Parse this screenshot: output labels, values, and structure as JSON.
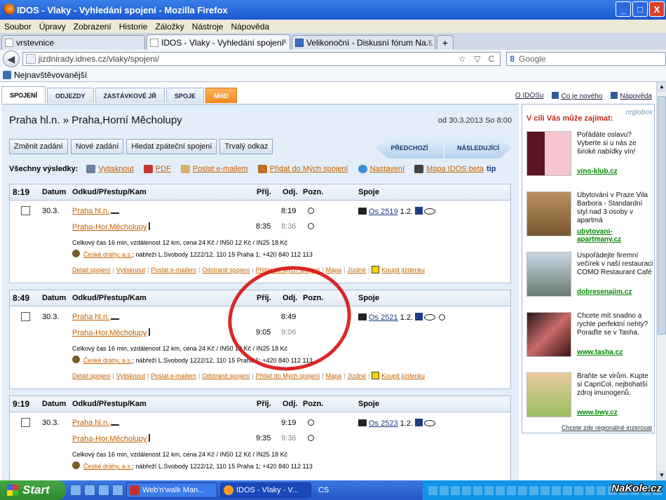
{
  "window": {
    "title": "IDOS - Vlaky - Vyhledání spojení - Mozilla Firefox",
    "min": "_",
    "max": "□",
    "close": "X"
  },
  "menu": [
    "Soubor",
    "Úpravy",
    "Zobrazení",
    "Historie",
    "Záložky",
    "Nástroje",
    "Nápověda"
  ],
  "tabs": [
    {
      "label": "vrstevnice"
    },
    {
      "label": "IDOS - Vlaky - Vyhledání spojení",
      "close": "x"
    },
    {
      "label": "Velikonoční - Diskusní fórum Na...",
      "close": "x"
    }
  ],
  "newtab": "+",
  "url": "jizdnirady.idnes.cz/vlaky/spojeni/",
  "url_icons": "☆ ▽ C",
  "search": {
    "engine": "8",
    "placeholder": "Google"
  },
  "bookmark": "Nejnavštěvovanější",
  "site": {
    "tabs": [
      "SPOJENÍ",
      "ODJEZDY",
      "ZASTÁVKOVÉ JŘ",
      "SPOJE",
      "MHD"
    ],
    "toplinks": [
      "O IDOSu",
      "Co je nového",
      "Nápověda"
    ],
    "route": "Praha hl.n. » Praha,Horní Měcholupy",
    "date": "od 30.3.2013 So 8:00",
    "buttons": [
      "Změnit zadání",
      "Nové zadání",
      "Hledat zpáteční spojení",
      "Trvalý odkaz"
    ],
    "prev": "PŘEDCHOZÍ",
    "next": "NÁSLEDUJÍCÍ",
    "all_results": "Všechny výsledky:",
    "actions": [
      "Vytisknout",
      "PDF",
      "Poslat e-mailem",
      "Přidat do Mých spojení",
      "Nastavení",
      "Mapa IDOS beta"
    ],
    "tip": "tip",
    "headers": {
      "datum": "Datum",
      "odkud": "Odkud/Přestup/Kam",
      "prij": "Příj.",
      "odj": "Odj.",
      "pozn": "Pozn.",
      "spoje": "Spoje"
    }
  },
  "connections": [
    {
      "time": "8:19",
      "date": "30.3.",
      "from": "Praha hl.n.",
      "to": "Praha-Hor.Měcholupy",
      "dep1": "8:19",
      "arr2": "8:35",
      "dep2": "8:36",
      "train": "Os 2519",
      "cls": "1.2.",
      "summary": "Celkový čas 16 min, vzdálenost 12 km, cena 24 Kč / IN50 12 Kč / IN25 18 Kč",
      "carrier": "České dráhy, a.s.",
      "address": "; nábřeží L.Svobody 1222/12, 110 15 Praha 1; +420 840 112 113",
      "links": [
        "Detail spojení",
        "Vytisknout",
        "Poslat e-mailem",
        "Odstranit spojení",
        "Přidat do Mých spojení",
        "Mapa",
        "Jízdné"
      ],
      "buy": "Koupit jízdenku"
    },
    {
      "time": "8:49",
      "date": "30.3.",
      "from": "Praha hl.n.",
      "to": "Praha-Hor.Měcholupy",
      "dep1": "8:49",
      "arr2": "9:05",
      "dep2": "9:06",
      "train": "Os 2521",
      "cls": "1.2.",
      "summary": "Celkový čas 16 min, vzdálenost 12 km, cena 24 Kč / IN50 12 Kč / IN25 18 Kč",
      "carrier": "České dráhy, a.s.",
      "address": "; nábřeží L.Svobody 1222/12, 110 15 Praha 1; +420 840 112 113",
      "links": [
        "Detail spojení",
        "Vytisknout",
        "Poslat e-mailem",
        "Odstranit spojení",
        "Přidat do Mých spojení",
        "Mapa",
        "Jízdné"
      ],
      "buy": "Koupit jízdenku"
    },
    {
      "time": "9:19",
      "date": "30.3.",
      "from": "Praha hl.n.",
      "to": "Praha-Hor.Měcholupy",
      "dep1": "9:19",
      "arr2": "9:35",
      "dep2": "9:36",
      "train": "Os 2523",
      "cls": "1.2.",
      "summary": "Celkový čas 16 min, vzdálenost 12 km, cena 24 Kč / IN50 12 Kč / IN25 18 Kč",
      "carrier": "České dráhy, a.s.",
      "address": "; nábřeží L.Svobody 1222/12, 110 15 Praha 1; +420 840 112 113"
    }
  ],
  "side": {
    "heading": "V cíli Vás může zajímat:",
    "logo": "regiobox",
    "ads": [
      {
        "text": "Pořádáte oslavu? Vyberte si u nás ze široké nabídky vín!",
        "url": "vino-klub.cz"
      },
      {
        "text": "Ubytování v Praze Vila Barbora - Standardní styl nad 3 osoby v apartmá",
        "url": "ubytovani-apartmany.cz"
      },
      {
        "text": "Uspořádejte firemní večírek v naší restauraci COMO Restaurant Café",
        "url": "dobresenajim.cz"
      },
      {
        "text": "Chcete mít snadno a rychle perfektní nehty? Poraďte se v Tasha.",
        "url": "www.tasha.cz"
      },
      {
        "text": "Braňte se virům. Kupte si CapriCol, nejbohatší zdroj imunogenů.",
        "url": "www.bwy.cz"
      }
    ],
    "footer": "Chcete zde regionálně inzerovat"
  },
  "taskbar": {
    "start": "Start",
    "items": [
      "Web'n'walk Man...",
      "IDOS - Vlaky - V..."
    ],
    "lang": "CS",
    "watermark": "NaKole.cz"
  }
}
